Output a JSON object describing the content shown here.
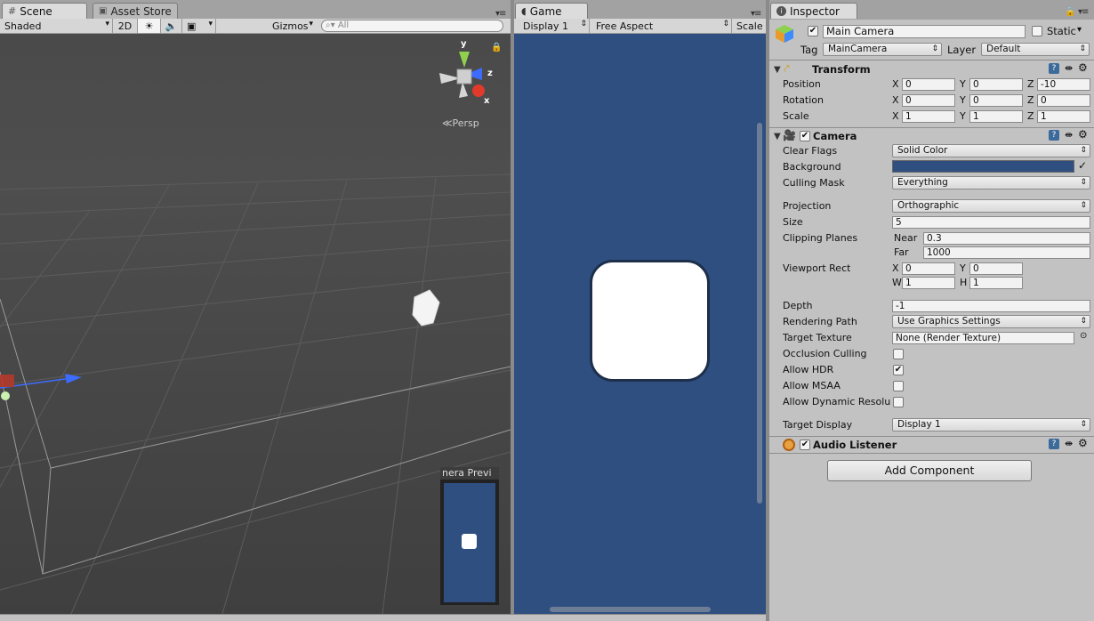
{
  "scene_tab": {
    "label": "Scene",
    "icon": "hash-icon"
  },
  "asset_store_tab": {
    "label": "Asset Store",
    "icon": "bag-icon"
  },
  "game_tab": {
    "label": "Game",
    "icon": "pacman-icon"
  },
  "inspector_tab": {
    "label": "Inspector",
    "icon": "info-icon"
  },
  "scene_toolbar": {
    "shading": "Shaded",
    "mode_2d": "2D",
    "gizmos": "Gizmos",
    "search_placeholder": "All"
  },
  "gizmo": {
    "y": "y",
    "z": "z",
    "x": "x",
    "projection": "Persp"
  },
  "camera_preview": {
    "title": "nera Previ"
  },
  "game_toolbar": {
    "display": "Display 1",
    "aspect": "Free Aspect",
    "scale": "Scale"
  },
  "colors": {
    "game_bg": "#2e4f80",
    "scene_bg": "#474747",
    "inspector_bg": "#c2c2c2"
  },
  "object": {
    "name": "Main Camera",
    "static_label": "Static",
    "tag_label": "Tag",
    "tag": "MainCamera",
    "layer_label": "Layer",
    "layer": "Default"
  },
  "transform": {
    "title": "Transform",
    "position_label": "Position",
    "pos_x": "0",
    "pos_y": "0",
    "pos_z": "-10",
    "rotation_label": "Rotation",
    "rot_x": "0",
    "rot_y": "0",
    "rot_z": "0",
    "scale_label": "Scale",
    "scale_x": "1",
    "scale_y": "1",
    "scale_z": "1",
    "x": "X",
    "y": "Y",
    "z": "Z"
  },
  "camera": {
    "title": "Camera",
    "clear_flags_label": "Clear Flags",
    "clear_flags": "Solid Color",
    "background_label": "Background",
    "culling_mask_label": "Culling Mask",
    "culling_mask": "Everything",
    "projection_label": "Projection",
    "projection": "Orthographic",
    "size_label": "Size",
    "size": "5",
    "clipping_label": "Clipping Planes",
    "near_label": "Near",
    "near": "0.3",
    "far_label": "Far",
    "far": "1000",
    "viewport_label": "Viewport Rect",
    "vx": "0",
    "vy": "0",
    "vw": "1",
    "vh": "1",
    "w": "W",
    "h": "H",
    "depth_label": "Depth",
    "depth": "-1",
    "rendering_path_label": "Rendering Path",
    "rendering_path": "Use Graphics Settings",
    "target_texture_label": "Target Texture",
    "target_texture": "None (Render Texture)",
    "occlusion_label": "Occlusion Culling",
    "hdr_label": "Allow HDR",
    "msaa_label": "Allow MSAA",
    "dynamic_label": "Allow Dynamic Resolu",
    "target_display_label": "Target Display",
    "target_display": "Display 1"
  },
  "audio_listener": {
    "title": "Audio Listener"
  },
  "add_component": "Add Component"
}
